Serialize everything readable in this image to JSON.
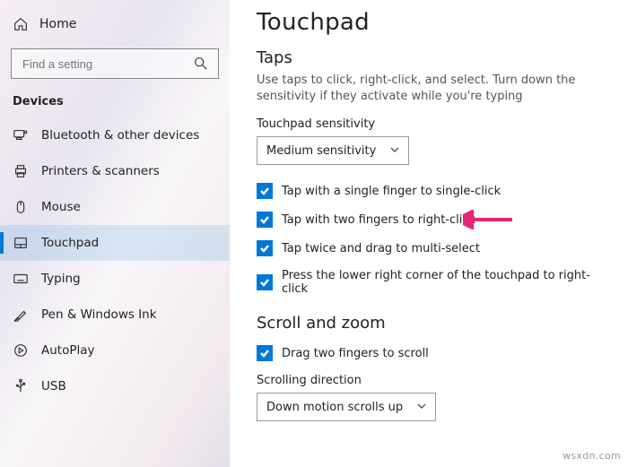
{
  "sidebar": {
    "home": "Home",
    "search_placeholder": "Find a setting",
    "section": "Devices",
    "items": [
      {
        "label": "Bluetooth & other devices"
      },
      {
        "label": "Printers & scanners"
      },
      {
        "label": "Mouse"
      },
      {
        "label": "Touchpad"
      },
      {
        "label": "Typing"
      },
      {
        "label": "Pen & Windows Ink"
      },
      {
        "label": "AutoPlay"
      },
      {
        "label": "USB"
      }
    ]
  },
  "page": {
    "title": "Touchpad",
    "taps": {
      "heading": "Taps",
      "description": "Use taps to click, right-click, and select. Turn down the sensitivity if they activate while you're typing",
      "sensitivity_label": "Touchpad sensitivity",
      "sensitivity_value": "Medium sensitivity",
      "options": [
        "Tap with a single finger to single-click",
        "Tap with two fingers to right-click",
        "Tap twice and drag to multi-select",
        "Press the lower right corner of the touchpad to right-click"
      ]
    },
    "scroll": {
      "heading": "Scroll and zoom",
      "option": "Drag two fingers to scroll",
      "direction_label": "Scrolling direction",
      "direction_value": "Down motion scrolls up"
    }
  },
  "watermark": "wsxdn.com"
}
